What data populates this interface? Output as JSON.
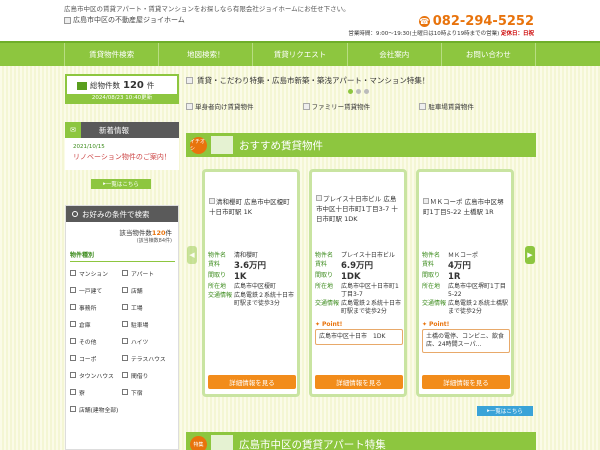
{
  "header": {
    "tagline": "広島市中区の賃貸アパート・賃貸マンションをお探しなら有限会社ジョイホームにお任せ下さい。",
    "logo_alt": "広島市中区の不動産屋ジョイホーム",
    "phone": "082-294-5252",
    "hours_prefix": "営業時間：9:00～19:30(土曜日は10時より19時までの営業)",
    "hours_closed": "定休日：日祝"
  },
  "nav": [
    "賃貸物件検索",
    "地図検索！",
    "賃貸リクエスト",
    "会社案内",
    "お問い合わせ"
  ],
  "count": {
    "label": "総物件数",
    "number": "120",
    "unit": "件",
    "updated": "2024/08/23 10:40更新"
  },
  "news": {
    "heading": "新着情報",
    "date": "2021/10/15",
    "title": "リノベーション物件のご案内！",
    "more": "一覧はこちら"
  },
  "search": {
    "heading": "お好みの条件で検索",
    "hit_label": "該当物件数",
    "hit_number": "120",
    "hit_unit": "件",
    "hit_sub": "(該当棟数84件)",
    "section": "物件種別",
    "options": [
      "マンション",
      "アパート",
      "一戸建て",
      "店舗",
      "事務所",
      "工場",
      "倉庫",
      "駐車場",
      "その他",
      "ハイツ",
      "コーポ",
      "テラスハウス",
      "タウンハウス",
      "間借り",
      "寮",
      "下宿",
      "店舗(建物全部)"
    ]
  },
  "banner": {
    "text": "賃貸・こだわり特集・広島市新築・築浅アパート・マンション特集！",
    "cats": [
      "単身者向け賃貸物件",
      "ファミリー賃貸物件",
      "駐車場賃貸物件"
    ]
  },
  "recommend": {
    "icon_text": "イチオシ",
    "heading": "おすすめ賃貸物件",
    "labels": {
      "name": "物件名",
      "rent": "賃料",
      "layout": "間取り",
      "address": "所在地",
      "access": "交通情報"
    },
    "point": "Point!",
    "detail": "詳細情報を見る",
    "more": "一覧はこちら",
    "cards": [
      {
        "img_alt": "清和櫻町 広島市中区榎町 十日市町駅 1K",
        "name": "清和櫻町",
        "rent": "3.6万円",
        "layout": "1K",
        "address": "広島市中区榎町",
        "access": "広島電鉄２系統十日市町駅まで徒歩3分",
        "point_text": ""
      },
      {
        "img_alt": "プレイス十日市ビル 広島市中区十日市町1丁目3-7 十日市町駅 1DK",
        "name": "プレイス十日市ビル",
        "rent": "6.9万円",
        "layout": "1DK",
        "address": "広島市中区十日市町1丁目3-7",
        "access": "広島電鉄２系統十日市町駅まで徒歩2分",
        "point_text": "広島市中区十日市　1DK"
      },
      {
        "img_alt": "ＭＫコーポ 広島市中区堺町1丁目5-22 土橋駅 1R",
        "name": "ＭＫコーポ",
        "rent": "4万円",
        "layout": "1R",
        "address": "広島市中区堺町1丁目5-22",
        "access": "広島電鉄２系統土橋駅まで徒歩2分",
        "point_text": "土橋の電停、コンビニ、飲食店、24時間スーパ..."
      }
    ]
  },
  "special": {
    "icon_text": "特集",
    "heading": "広島市中区の賃貸アパート特集"
  }
}
